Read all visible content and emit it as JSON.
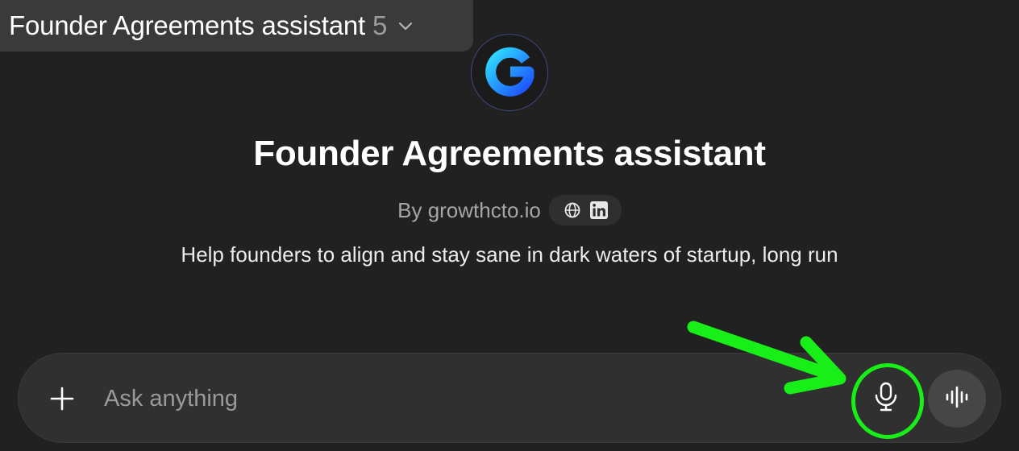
{
  "header": {
    "gpt_name": "Founder Agreements assistant",
    "version": "5"
  },
  "gpt": {
    "title": "Founder Agreements assistant",
    "byline": "By growthcto.io",
    "description": "Help founders to align and stay sane in dark waters of startup, long run"
  },
  "icons": {
    "logo": "letter-g-logo",
    "website": "globe-icon",
    "linkedin": "linkedin-icon",
    "add": "plus-icon",
    "dictate": "microphone-icon",
    "voice_mode": "waveform-icon",
    "switcher": "chevron-down-icon"
  },
  "composer": {
    "placeholder": "Ask anything"
  },
  "colors": {
    "background": "#212121",
    "composer": "#303030",
    "annotation": "#18ee18",
    "logo_gradient_start": "#2ec8ff",
    "logo_gradient_end": "#1d5bff"
  }
}
